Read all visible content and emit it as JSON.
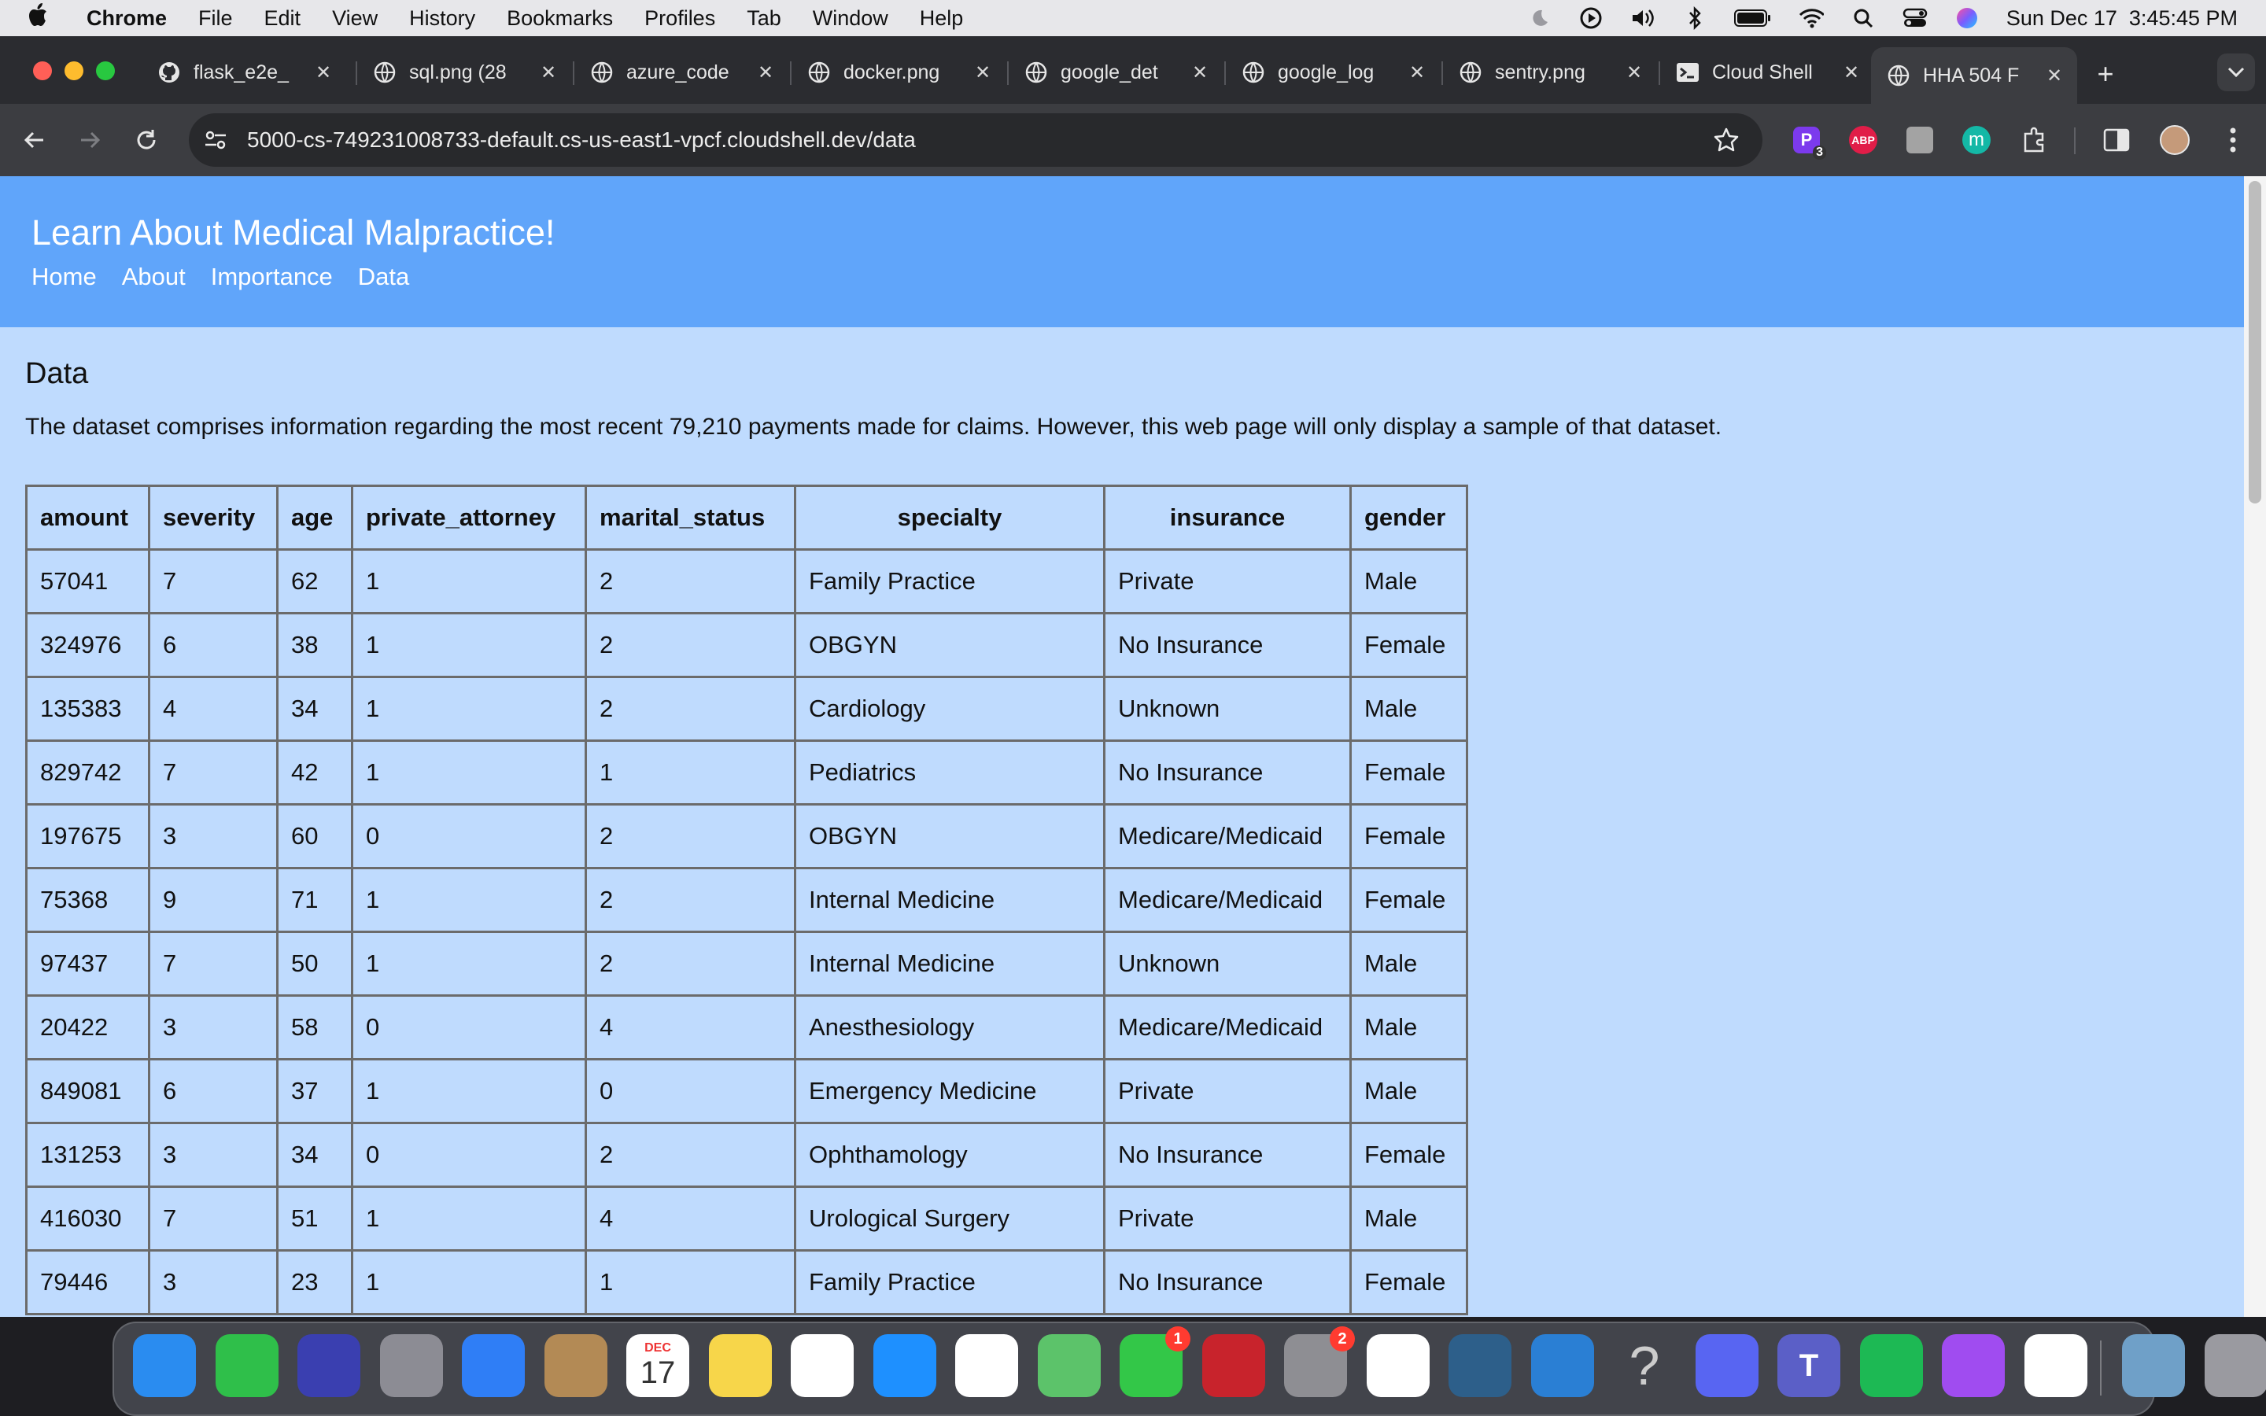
{
  "menubar": {
    "app": "Chrome",
    "items": [
      "File",
      "Edit",
      "View",
      "History",
      "Bookmarks",
      "Profiles",
      "Tab",
      "Window",
      "Help"
    ],
    "status_icons": [
      "moon-icon",
      "play-icon",
      "volume-icon",
      "bluetooth-icon",
      "battery-icon",
      "wifi-icon",
      "spotlight-icon",
      "control-center-icon",
      "siri-icon"
    ],
    "datetime": "Sun Dec 17  3:45:45 PM"
  },
  "tabs": [
    {
      "title": "flask_e2e_",
      "icon": "github-icon"
    },
    {
      "title": "sql.png (28",
      "icon": "globe-icon"
    },
    {
      "title": "azure_code",
      "icon": "globe-icon"
    },
    {
      "title": "docker.png",
      "icon": "globe-icon"
    },
    {
      "title": "google_det",
      "icon": "globe-icon"
    },
    {
      "title": "google_log",
      "icon": "globe-icon"
    },
    {
      "title": "sentry.png",
      "icon": "globe-icon"
    },
    {
      "title": "Cloud Shell",
      "icon": "terminal-icon"
    },
    {
      "title": "HHA 504 F",
      "icon": "globe-icon",
      "active": true
    }
  ],
  "toolbar": {
    "url": "5000-cs-749231008733-default.cs-us-east1-vpcf.cloudshell.dev/data",
    "extension_badge": "3",
    "abp_label": "ABP",
    "m_label": "m"
  },
  "site": {
    "title": "Learn About Medical Malpractice!",
    "nav": [
      "Home",
      "About",
      "Importance",
      "Data"
    ]
  },
  "content": {
    "heading": "Data",
    "description": "The dataset comprises information regarding the most recent 79,210 payments made for claims. However, this web page will only display a sample of that dataset."
  },
  "table": {
    "columns": [
      "amount",
      "severity",
      "age",
      "private_attorney",
      "marital_status",
      "specialty",
      "insurance",
      "gender"
    ],
    "rows": [
      [
        "57041",
        "7",
        "62",
        "1",
        "2",
        "Family Practice",
        "Private",
        "Male"
      ],
      [
        "324976",
        "6",
        "38",
        "1",
        "2",
        "OBGYN",
        "No Insurance",
        "Female"
      ],
      [
        "135383",
        "4",
        "34",
        "1",
        "2",
        "Cardiology",
        "Unknown",
        "Male"
      ],
      [
        "829742",
        "7",
        "42",
        "1",
        "1",
        "Pediatrics",
        "No Insurance",
        "Female"
      ],
      [
        "197675",
        "3",
        "60",
        "0",
        "2",
        "OBGYN",
        "Medicare/Medicaid",
        "Female"
      ],
      [
        "75368",
        "9",
        "71",
        "1",
        "2",
        "Internal Medicine",
        "Medicare/Medicaid",
        "Female"
      ],
      [
        "97437",
        "7",
        "50",
        "1",
        "2",
        "Internal Medicine",
        "Unknown",
        "Male"
      ],
      [
        "20422",
        "3",
        "58",
        "0",
        "4",
        "Anesthesiology",
        "Medicare/Medicaid",
        "Male"
      ],
      [
        "849081",
        "6",
        "37",
        "1",
        "0",
        "Emergency Medicine",
        "Private",
        "Male"
      ],
      [
        "131253",
        "3",
        "34",
        "0",
        "2",
        "Ophthamology",
        "No Insurance",
        "Female"
      ],
      [
        "416030",
        "7",
        "51",
        "1",
        "4",
        "Urological Surgery",
        "Private",
        "Male"
      ],
      [
        "79446",
        "3",
        "23",
        "1",
        "1",
        "Family Practice",
        "No Insurance",
        "Female"
      ]
    ]
  },
  "dock": {
    "apps": [
      {
        "name": "finder",
        "label": "",
        "color": "#2a8cf0"
      },
      {
        "name": "facetime",
        "label": "",
        "color": "#2fbf4a"
      },
      {
        "name": "siri",
        "label": "",
        "color": "#3a3fb0"
      },
      {
        "name": "launchpad",
        "label": "",
        "color": "#8c8c94"
      },
      {
        "name": "mail",
        "label": "",
        "color": "#2f7ef6"
      },
      {
        "name": "contacts",
        "label": "",
        "color": "#b38a55"
      },
      {
        "name": "calendar",
        "label": "17",
        "month": "DEC",
        "color": "#ffffff"
      },
      {
        "name": "notes",
        "label": "",
        "color": "#f7d64a"
      },
      {
        "name": "freeform",
        "label": "",
        "color": "#ffffff"
      },
      {
        "name": "app-store",
        "label": "",
        "color": "#1e90ff"
      },
      {
        "name": "reminders",
        "label": "",
        "color": "#ffffff"
      },
      {
        "name": "maps",
        "label": "",
        "color": "#5cc36a"
      },
      {
        "name": "messages",
        "label": "",
        "color": "#33c748",
        "badge": "1"
      },
      {
        "name": "photo-booth",
        "label": "",
        "color": "#c8232c"
      },
      {
        "name": "system-settings",
        "label": "",
        "color": "#8e8e93",
        "badge": "2"
      },
      {
        "name": "tableau",
        "label": "",
        "color": "#ffffff"
      },
      {
        "name": "mysql-workbench",
        "label": "",
        "color": "#2d5f8a"
      },
      {
        "name": "vscode",
        "label": "",
        "color": "#2a7fd4"
      },
      {
        "name": "help",
        "label": "?",
        "color": "transparent"
      },
      {
        "name": "discord",
        "label": "",
        "color": "#5865f2"
      },
      {
        "name": "teams",
        "label": "T",
        "color": "#5b5fc7"
      },
      {
        "name": "spotify",
        "label": "",
        "color": "#1db954"
      },
      {
        "name": "messenger",
        "label": "",
        "color": "#a04cf0"
      },
      {
        "name": "chrome",
        "label": "",
        "color": "#ffffff"
      },
      {
        "name": "preview-screenshot",
        "label": "",
        "color": "#6fa0c8"
      },
      {
        "name": "trash",
        "label": "",
        "color": "#9a9aa0"
      }
    ]
  }
}
